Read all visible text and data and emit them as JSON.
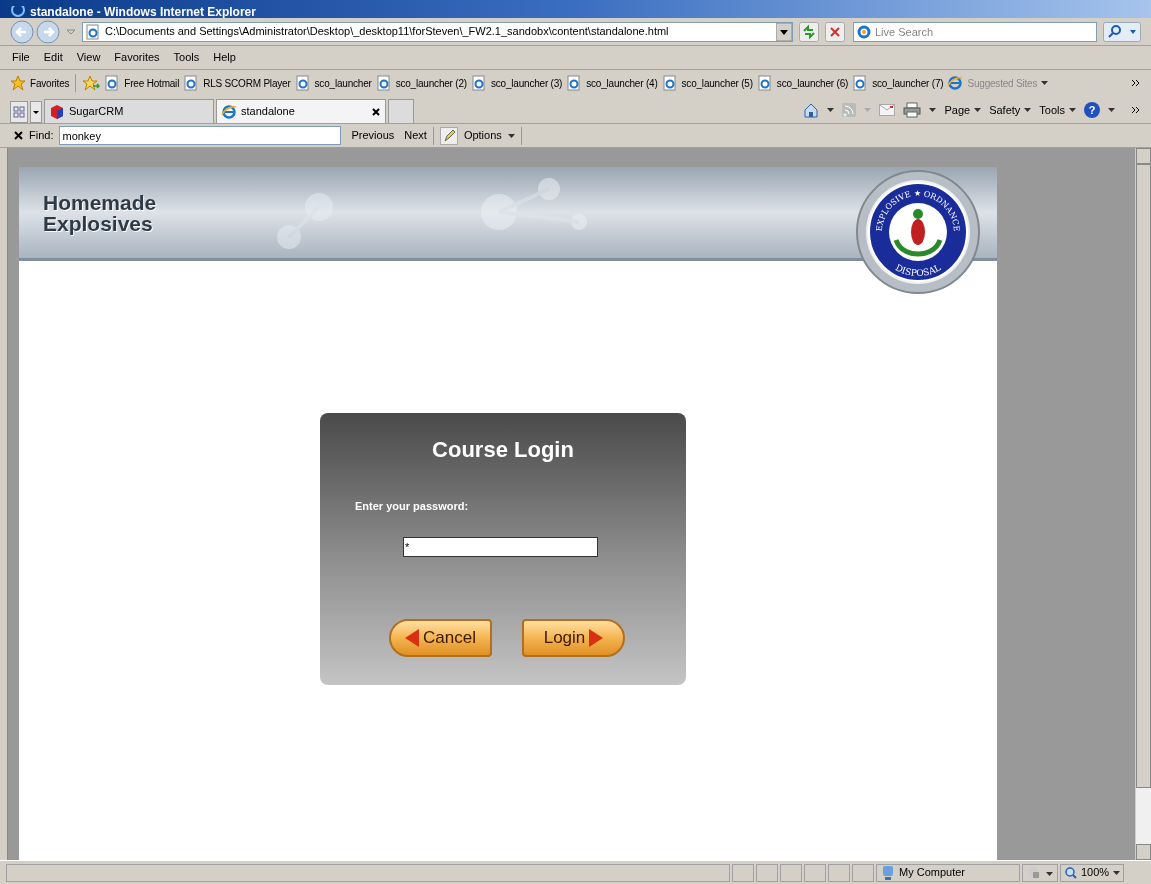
{
  "window": {
    "title": "standalone - Windows Internet Explorer"
  },
  "address_bar": {
    "url": "C:\\Documents and Settings\\Administrator\\Desktop\\_desktop11\\forSteven\\_FW2.1_sandobx\\content\\standalone.html"
  },
  "search": {
    "placeholder": "Live Search"
  },
  "menu": [
    "File",
    "Edit",
    "View",
    "Favorites",
    "Tools",
    "Help"
  ],
  "favorites_bar": {
    "label": "Favorites",
    "items": [
      "Free Hotmail",
      "RLS SCORM Player",
      "sco_launcher",
      "sco_launcher (2)",
      "sco_launcher (3)",
      "sco_launcher (4)",
      "sco_launcher (5)",
      "sco_launcher (6)",
      "sco_launcher (7)"
    ],
    "suggested": "Suggested Sites"
  },
  "tabs": [
    {
      "label": "SugarCRM",
      "selected": false
    },
    {
      "label": "standalone",
      "selected": true
    }
  ],
  "command_bar": [
    "Page",
    "Safety",
    "Tools"
  ],
  "help_button": "?",
  "find_bar": {
    "label": "Find:",
    "value": "monkey",
    "buttons": [
      "Previous",
      "Next"
    ],
    "options": "Options"
  },
  "page": {
    "banner": {
      "title_lines": [
        "Homemade",
        "Explosives"
      ],
      "emblem": {
        "top": "EXPLOSIVE ★ ORDNANCE",
        "bottom": "DISPOSAL"
      }
    },
    "login": {
      "title": "Course Login",
      "prompt": "Enter your password:",
      "password": "*",
      "buttons": [
        {
          "label": "Cancel",
          "kind": "back"
        },
        {
          "label": "Login",
          "kind": "forward"
        }
      ]
    }
  },
  "status_bar": {
    "zone": "My Computer",
    "zoom": "100%"
  }
}
